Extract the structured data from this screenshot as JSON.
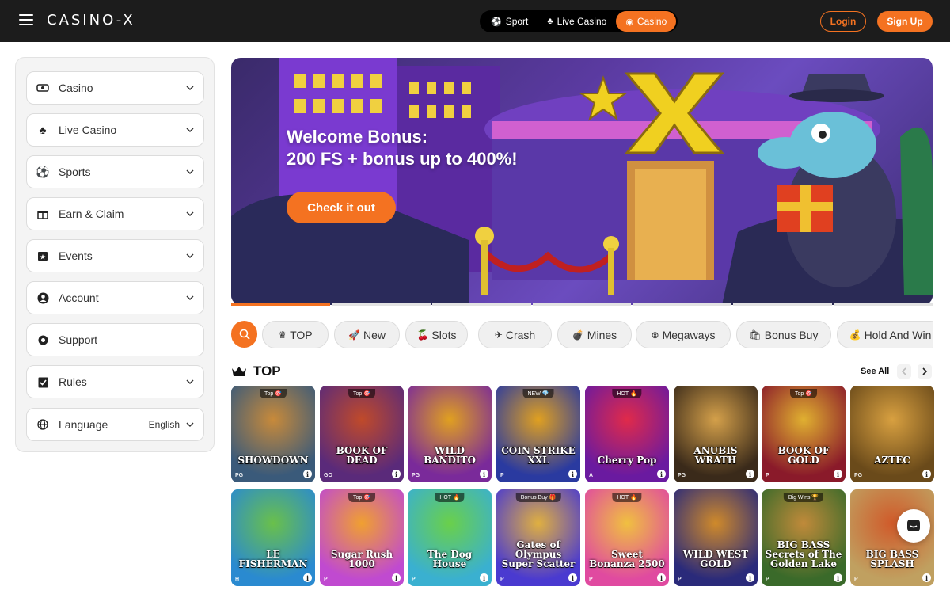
{
  "header": {
    "logo": "CASINO-X",
    "modes": [
      {
        "label": "Sport",
        "icon": "soccer-ball-icon",
        "active": false
      },
      {
        "label": "Live Casino",
        "icon": "live-casino-icon",
        "active": false
      },
      {
        "label": "Casino",
        "icon": "casino-chips-icon",
        "active": true
      }
    ],
    "login_label": "Login",
    "signup_label": "Sign Up"
  },
  "sidebar": {
    "items": [
      {
        "label": "Casino",
        "icon": "casino-icon",
        "has_chevron": true
      },
      {
        "label": "Live Casino",
        "icon": "live-casino-icon",
        "has_chevron": true
      },
      {
        "label": "Sports",
        "icon": "soccer-ball-icon",
        "has_chevron": true
      },
      {
        "label": "Earn & Claim",
        "icon": "gift-icon",
        "has_chevron": true
      },
      {
        "label": "Events",
        "icon": "calendar-star-icon",
        "has_chevron": true
      },
      {
        "label": "Account",
        "icon": "user-icon",
        "has_chevron": true
      },
      {
        "label": "Support",
        "icon": "support-icon",
        "has_chevron": false
      },
      {
        "label": "Rules",
        "icon": "clipboard-check-icon",
        "has_chevron": true
      }
    ],
    "language": {
      "label": "Language",
      "value": "English",
      "icon": "globe-icon"
    }
  },
  "banner": {
    "title_line1": "Welcome Bonus:",
    "title_line2": "200 FS + bonus up to 400%!",
    "cta_label": "Check it out",
    "slide_count": 7,
    "active_slide": 0
  },
  "categories": [
    {
      "label": "TOP",
      "icon": "crown-icon"
    },
    {
      "label": "New",
      "icon": "rocket-icon"
    },
    {
      "label": "Slots",
      "icon": "cherries-icon"
    },
    {
      "label": "Crash",
      "icon": "plane-icon"
    },
    {
      "label": "Mines",
      "icon": "bomb-icon"
    },
    {
      "label": "Megaways",
      "icon": "megaways-icon"
    },
    {
      "label": "Bonus Buy",
      "icon": "bonus-buy-icon"
    },
    {
      "label": "Hold And Win",
      "icon": "hold-and-win-icon"
    }
  ],
  "section": {
    "title": "TOP",
    "see_all_label": "See All"
  },
  "games": [
    {
      "title": "SHOWDOWN",
      "badge": "Top 🎯",
      "colors": [
        "#3a5a7a",
        "#c88a3a"
      ],
      "provider": "PG"
    },
    {
      "title": "BOOK OF DEAD",
      "badge": "Top 🎯",
      "colors": [
        "#5a2a7a",
        "#c04a2a"
      ],
      "provider": "GO"
    },
    {
      "title": "WILD BANDITO",
      "badge": "",
      "colors": [
        "#7a2a9a",
        "#e0a020"
      ],
      "provider": "PG"
    },
    {
      "title": "COIN STRIKE XXL",
      "badge": "NEW 💎",
      "colors": [
        "#2a3aa0",
        "#e0a020"
      ],
      "provider": "P"
    },
    {
      "title": "Cherry Pop",
      "badge": "HOT 🔥",
      "colors": [
        "#6a1aa0",
        "#e02a4a"
      ],
      "provider": "A"
    },
    {
      "title": "ANUBIS WRATH",
      "badge": "",
      "colors": [
        "#3a2a1a",
        "#d4a04a"
      ],
      "provider": "PG"
    },
    {
      "title": "BOOK OF GOLD",
      "badge": "Top 🎯",
      "colors": [
        "#8a1a2a",
        "#e0b030"
      ],
      "provider": "P"
    },
    {
      "title": "AZTEC",
      "badge": "",
      "colors": [
        "#6a4a1a",
        "#d8a040"
      ],
      "provider": "PG"
    },
    {
      "title": "LE FISHERMAN",
      "badge": "",
      "colors": [
        "#2a8ad0",
        "#6ac04a"
      ],
      "provider": "H"
    },
    {
      "title": "Sugar Rush 1000",
      "badge": "Top 🎯",
      "colors": [
        "#c04ad0",
        "#f0a030"
      ],
      "provider": "P"
    },
    {
      "title": "The Dog House",
      "badge": "HOT 🔥",
      "colors": [
        "#3ab0d0",
        "#6ad04a"
      ],
      "provider": "P"
    },
    {
      "title": "Gates of Olympus Super Scatter",
      "badge": "Bonus Buy 🎁",
      "colors": [
        "#4a3ad0",
        "#e0b040"
      ],
      "provider": "P"
    },
    {
      "title": "Sweet Bonanza 2500",
      "badge": "HOT 🔥",
      "colors": [
        "#e04aa0",
        "#f0c040"
      ],
      "provider": "P"
    },
    {
      "title": "WILD WEST GOLD",
      "badge": "",
      "colors": [
        "#2a2a7a",
        "#d08a2a"
      ],
      "provider": "P"
    },
    {
      "title": "BIG BASS Secrets of The Golden Lake",
      "badge": "Big Wins 🏆",
      "colors": [
        "#3a6a2a",
        "#c08a3a"
      ],
      "provider": "P"
    },
    {
      "title": "BIG BASS SPLASH",
      "badge": "",
      "colors": [
        "#c0a060",
        "#d05a2a"
      ],
      "provider": "P"
    }
  ]
}
